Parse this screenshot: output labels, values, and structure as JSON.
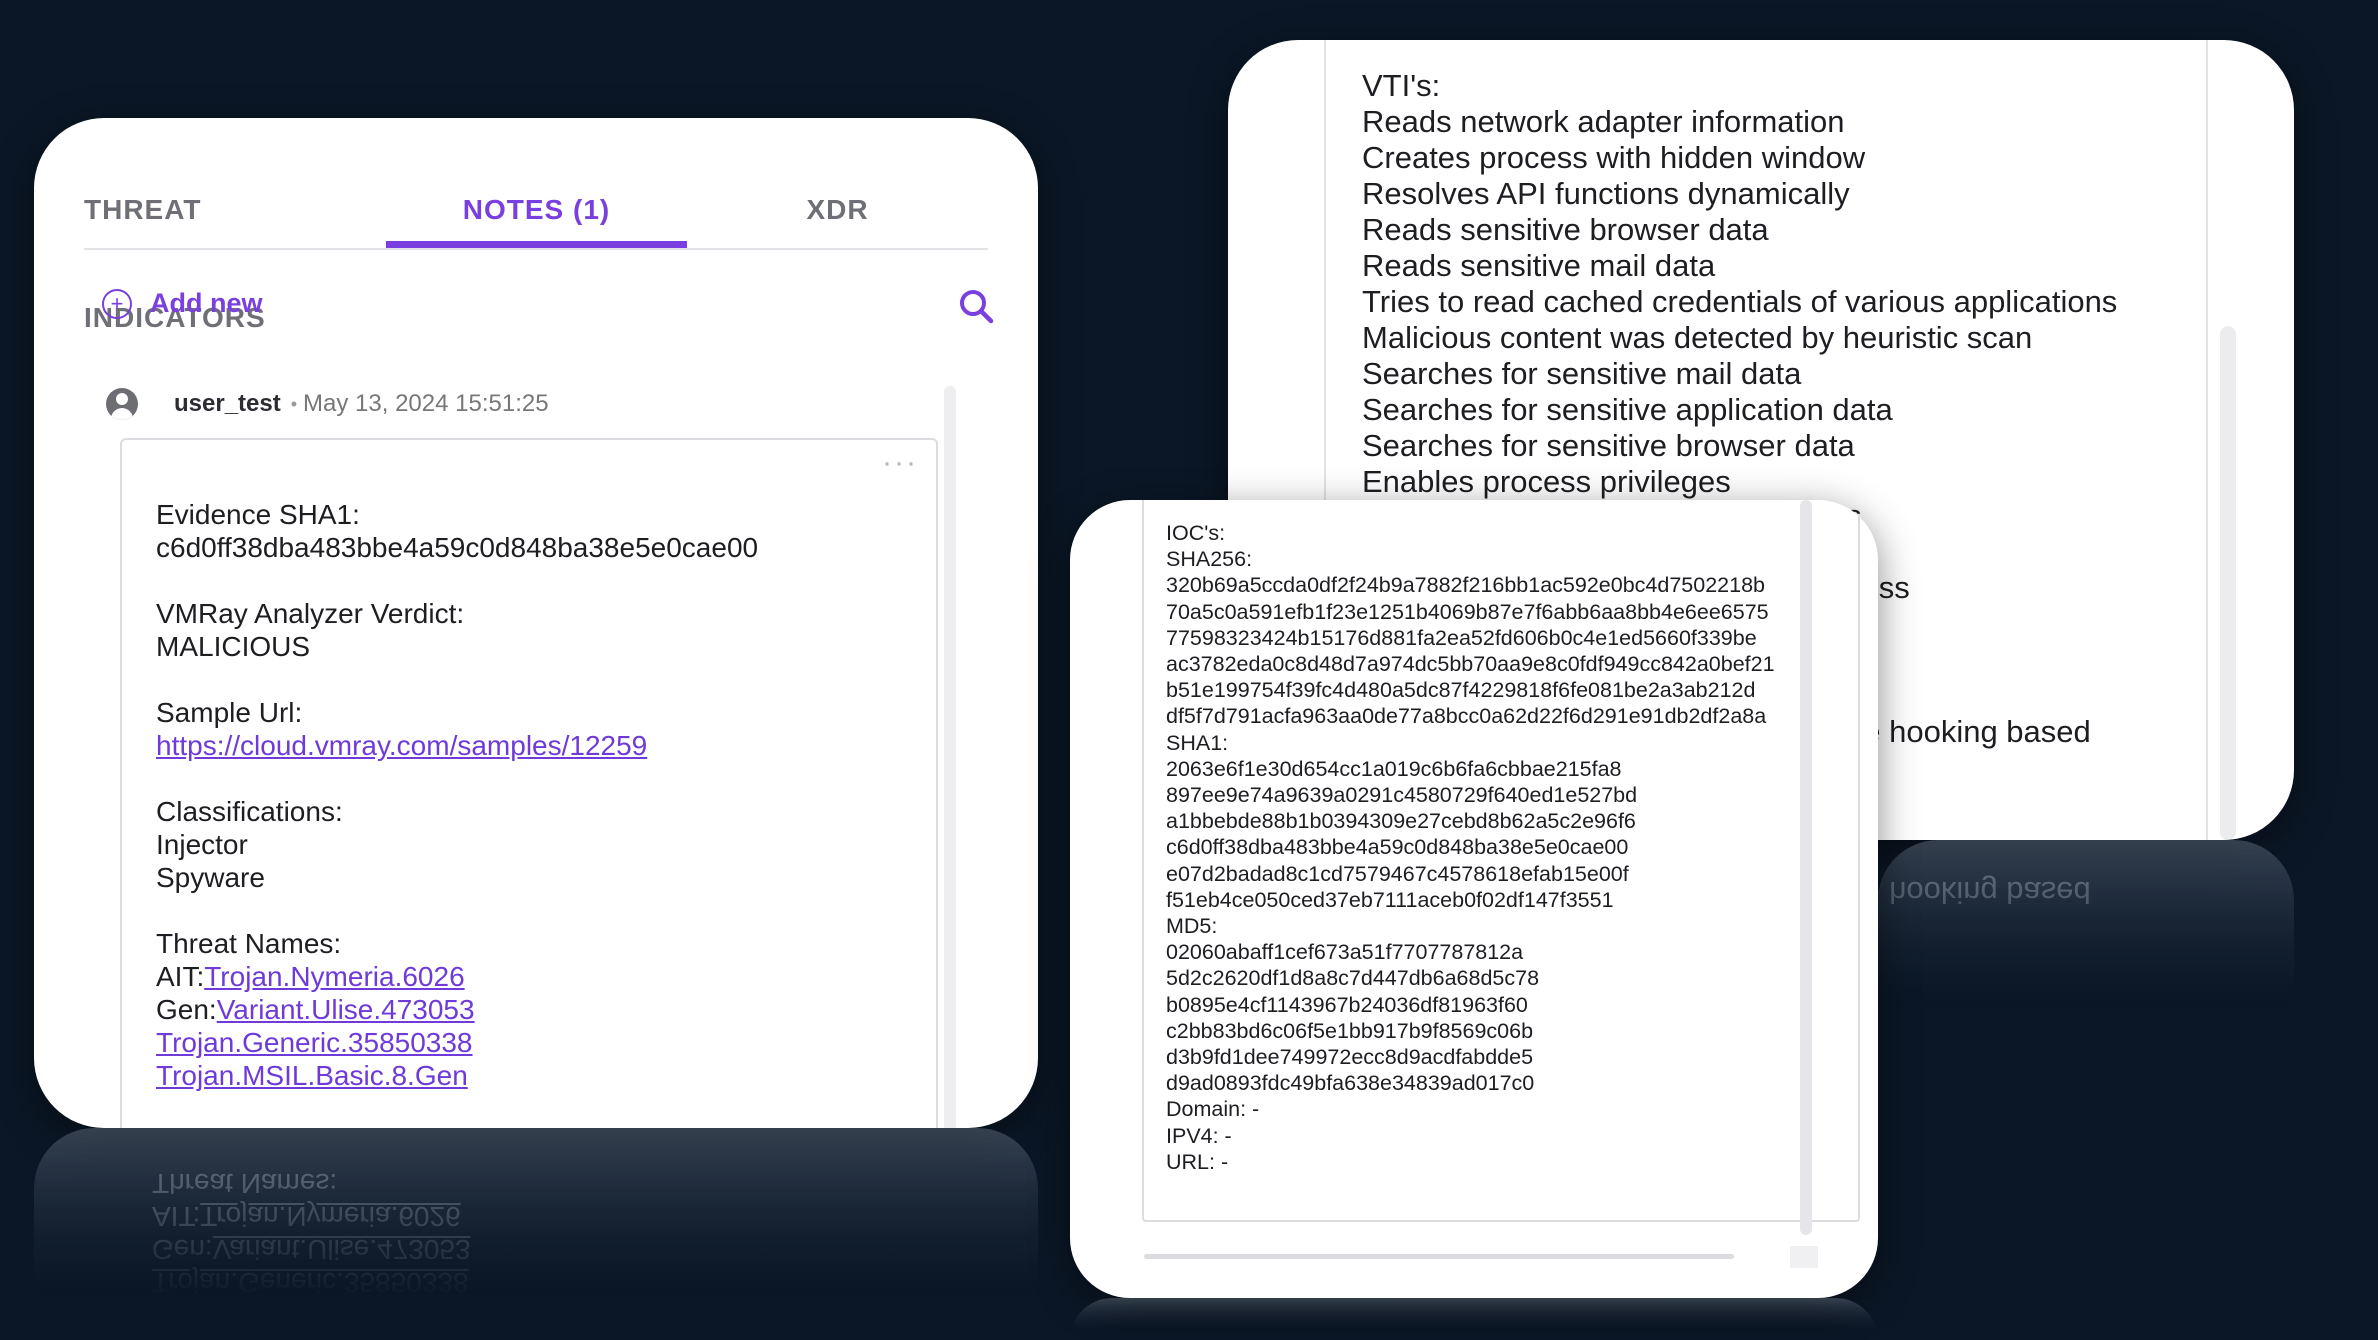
{
  "notes_panel": {
    "tabs": [
      {
        "label": "THREAT INDICATORS",
        "active": false
      },
      {
        "label": "NOTES (1)",
        "active": true
      },
      {
        "label": "XDR",
        "active": false
      }
    ],
    "add_new_label": "Add new",
    "note": {
      "user": "user_test",
      "timestamp": "May 13, 2024 15:51:25",
      "evidence_label": "Evidence SHA1:",
      "evidence_value": "c6d0ff38dba483bbe4a59c0d848ba38e5e0cae00",
      "verdict_label": "VMRay Analyzer Verdict:",
      "verdict_value": "MALICIOUS",
      "sample_url_label": "Sample Url:",
      "sample_url": "https://cloud.vmray.com/samples/12259",
      "classifications_label": "Classifications:",
      "classifications": [
        "Injector",
        "Spyware"
      ],
      "threat_names_label": "Threat Names:",
      "threat_names": [
        {
          "prefix": "AIT:",
          "name": "Trojan.Nymeria.6026"
        },
        {
          "prefix": "Gen:",
          "name": "Variant.Ulise.473053"
        },
        {
          "prefix": "",
          "name": "Trojan.Generic.35850338"
        },
        {
          "prefix": "",
          "name": "Trojan.MSIL.Basic.8.Gen"
        }
      ]
    }
  },
  "vti_panel": {
    "heading": "VTI's:",
    "items": [
      "Reads network adapter information",
      "Creates process with hidden window",
      "Resolves API functions dynamically",
      "Reads sensitive browser data",
      "Reads sensitive mail data",
      "Tries to read cached credentials of various applications",
      "Malicious content was detected by heuristic scan",
      "Searches for sensitive mail data",
      "Searches for sensitive application data",
      "Searches for sensitive browser data",
      "Enables process privileges"
    ],
    "partial_fragments": [
      "s",
      "cess",
      "s",
      "de hooking based"
    ]
  },
  "ioc_panel": {
    "heading": "IOC's:",
    "sha256_label": "SHA256:",
    "sha256": [
      "320b69a5ccda0df2f24b9a7882f216bb1ac592e0bc4d7502218b",
      "70a5c0a591efb1f23e1251b4069b87e7f6abb6aa8bb4e6ee6575",
      "77598323424b15176d881fa2ea52fd606b0c4e1ed5660f339be",
      "ac3782eda0c8d48d7a974dc5bb70aa9e8c0fdf949cc842a0bef21",
      "b51e199754f39fc4d480a5dc87f4229818f6fe081be2a3ab212d",
      "df5f7d791acfa963aa0de77a8bcc0a62d22f6d291e91db2df2a8a"
    ],
    "sha1_label": "SHA1:",
    "sha1": [
      "2063e6f1e30d654cc1a019c6b6fa6cbbae215fa8",
      "897ee9e74a9639a0291c4580729f640ed1e527bd",
      "a1bbebde88b1b0394309e27cebd8b62a5c2e96f6",
      "c6d0ff38dba483bbe4a59c0d848ba38e5e0cae00",
      "e07d2badad8c1cd7579467c4578618efab15e00f",
      "f51eb4ce050ced37eb7111aceb0f02df147f3551"
    ],
    "md5_label": "MD5:",
    "md5": [
      "02060abaff1cef673a51f7707787812a",
      "5d2c2620df1d8a8c7d447db6a68d5c78",
      "b0895e4cf1143967b24036df81963f60",
      "c2bb83bd6c06f5e1bb917b9f8569c06b",
      "d3b9fd1dee749972ecc8d9acdfabdde5",
      "d9ad0893fdc49bfa638e34839ad017c0"
    ],
    "domain": "Domain: -",
    "ipv4": "IPV4: -",
    "url": "URL: -"
  },
  "icons": {
    "add": "plus-circle-icon",
    "search": "magnifier-icon",
    "more": "kebab-menu-icon",
    "user": "user-avatar-icon"
  },
  "colors": {
    "accent": "#7a3fe0",
    "background": "#0b1726",
    "link": "#6e3ad9"
  }
}
